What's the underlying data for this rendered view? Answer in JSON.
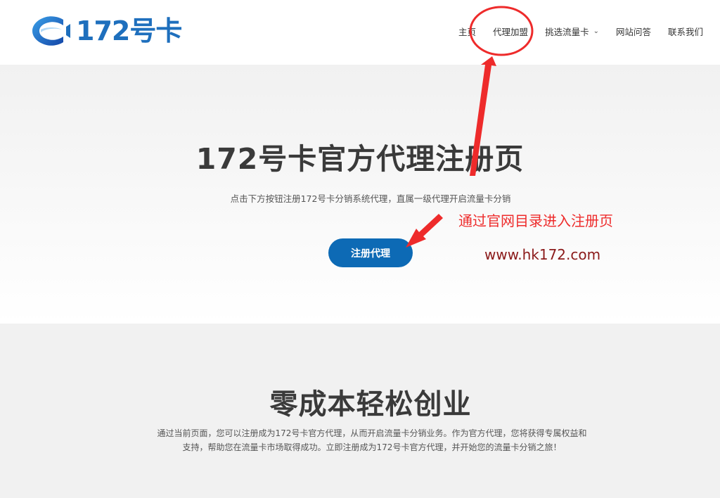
{
  "header": {
    "logo_text": "172号卡",
    "nav": [
      {
        "label": "主页"
      },
      {
        "label": "代理加盟"
      },
      {
        "label": "挑选流量卡",
        "has_dropdown": true
      },
      {
        "label": "网站问答"
      },
      {
        "label": "联系我们"
      }
    ]
  },
  "hero": {
    "title": "172号卡官方代理注册页",
    "subtitle": "点击下方按钮注册172号卡分销系统代理，直属一级代理开启流量卡分销",
    "cta_label": "注册代理"
  },
  "section2": {
    "title": "零成本轻松创业",
    "body": "通过当前页面，您可以注册成为172号卡官方代理，从而开启流量卡分销业务。作为官方代理，您将获得专属权益和支持，帮助您在流量卡市场取得成功。立即注册成为172号卡官方代理，并开始您的流量卡分销之旅！"
  },
  "annotations": {
    "note": "通过官网目录进入注册页",
    "url": "www.hk172.com",
    "color_red": "#ee2b2b",
    "color_url": "#8b1a1a"
  },
  "colors": {
    "brand_blue": "#1e6fbd",
    "cta_blue": "#0d6ab5"
  }
}
